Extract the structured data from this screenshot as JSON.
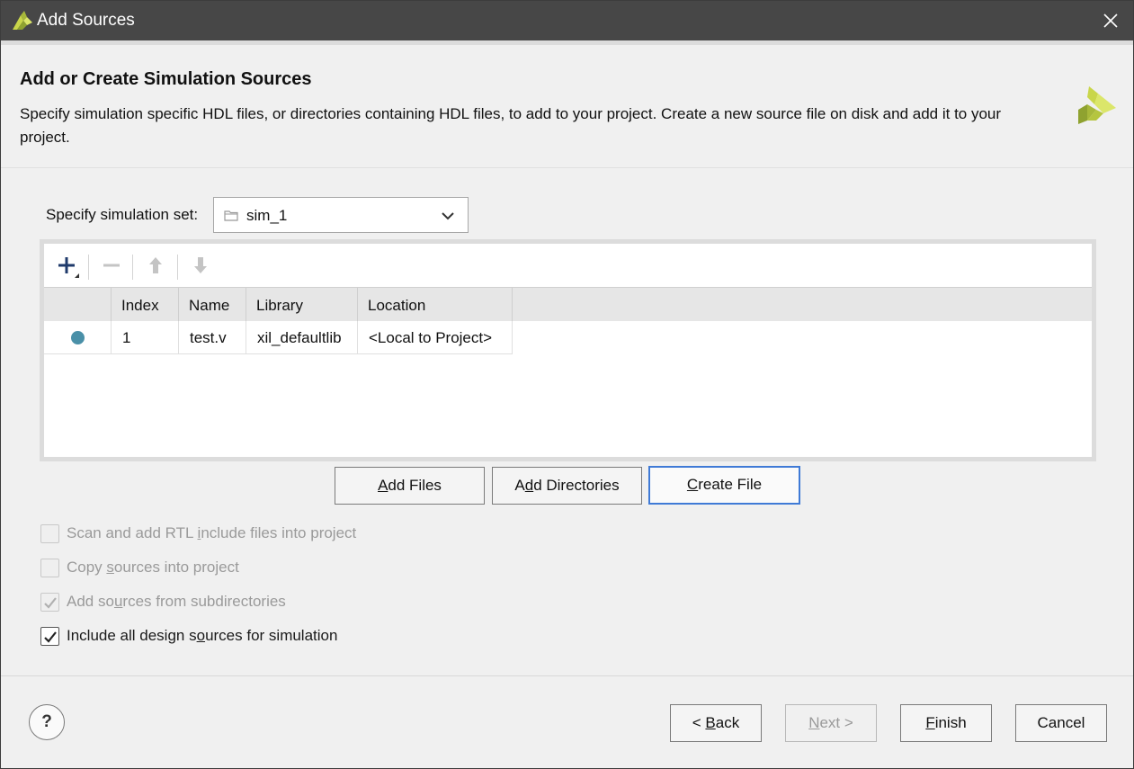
{
  "window": {
    "title": "Add Sources",
    "close_icon": "close-icon",
    "app_icon": "xilinx-logo-icon"
  },
  "header": {
    "title": "Add or Create Simulation Sources",
    "description": "Specify simulation specific HDL files, or directories containing HDL files, to add to your project. Create a new source file on disk and add it to your project."
  },
  "simset": {
    "label": "Specify simulation set:",
    "value": "sim_1"
  },
  "toolbar": {
    "add_icon": "plus-icon",
    "remove_icon": "minus-icon",
    "up_icon": "arrow-up-icon",
    "down_icon": "arrow-down-icon"
  },
  "table": {
    "columns": [
      "",
      "Index",
      "Name",
      "Library",
      "Location"
    ],
    "rows": [
      {
        "status": "dot",
        "index": "1",
        "name": "test.v",
        "library": "xil_defaultlib",
        "location": "<Local to Project>"
      }
    ]
  },
  "actions": {
    "add_files": {
      "pre": "",
      "ul": "A",
      "post": "dd Files"
    },
    "add_directories": {
      "pre": "A",
      "ul": "d",
      "post": "d Directories"
    },
    "create_file": {
      "pre": "",
      "ul": "C",
      "post": "reate File"
    }
  },
  "options": [
    {
      "pre": "Scan and add RTL ",
      "ul": "i",
      "post": "nclude files into project",
      "checked": false,
      "enabled": false
    },
    {
      "pre": "Copy ",
      "ul": "s",
      "post": "ources into project",
      "checked": false,
      "enabled": false
    },
    {
      "pre": "Add so",
      "ul": "u",
      "post": "rces from subdirectories",
      "checked": true,
      "enabled": false
    },
    {
      "pre": "Include all design s",
      "ul": "o",
      "post": "urces for simulation",
      "checked": true,
      "enabled": true
    }
  ],
  "footer": {
    "help": "?",
    "back": {
      "pre": "< ",
      "ul": "B",
      "post": "ack"
    },
    "next": {
      "pre": "",
      "ul": "N",
      "post": "ext >"
    },
    "finish": {
      "pre": "",
      "ul": "F",
      "post": "inish"
    },
    "cancel": "Cancel"
  },
  "colors": {
    "titlebar": "#474747",
    "status_dot": "#4a90a8",
    "primary_border": "#3f7ad6"
  }
}
